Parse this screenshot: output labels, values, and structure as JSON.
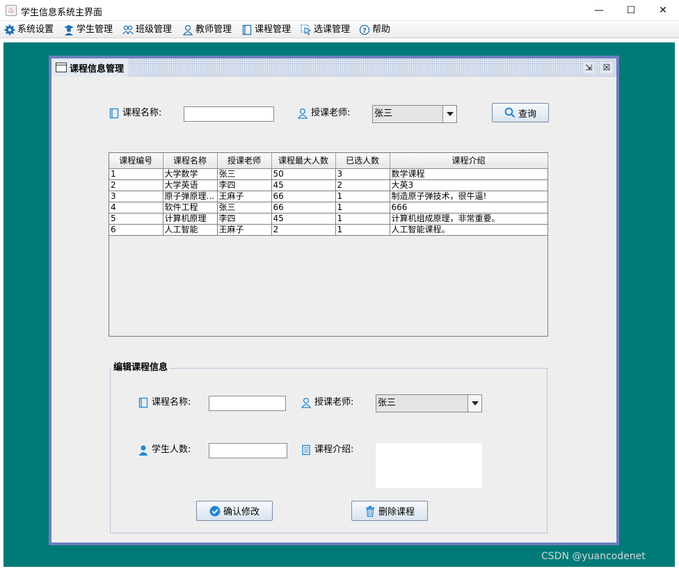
{
  "window": {
    "title": "学生信息系统主界面",
    "minimize": "—",
    "maximize": "☐",
    "close": "✕"
  },
  "menu": [
    {
      "label": "系统设置",
      "icon": "gear-icon"
    },
    {
      "label": "学生管理",
      "icon": "student-icon"
    },
    {
      "label": "班级管理",
      "icon": "class-icon"
    },
    {
      "label": "教师管理",
      "icon": "teacher-icon"
    },
    {
      "label": "课程管理",
      "icon": "book-icon"
    },
    {
      "label": "选课管理",
      "icon": "cursor-select-icon"
    },
    {
      "label": "帮助",
      "icon": "help-icon"
    }
  ],
  "frame": {
    "title": "课程信息管理",
    "restore": "⇲",
    "close": "☒"
  },
  "search": {
    "course_label": "课程名称:",
    "course_value": "",
    "teacher_label": "授课老师:",
    "teacher_value": "张三",
    "query_button": "查询"
  },
  "table": {
    "columns": [
      "课程编号",
      "课程名称",
      "授课老师",
      "课程最大人数",
      "已选人数",
      "课程介绍"
    ],
    "rows": [
      [
        "1",
        "大学数学",
        "张三",
        "50",
        "3",
        "数学课程"
      ],
      [
        "2",
        "大学英语",
        "李四",
        "45",
        "2",
        "大英3"
      ],
      [
        "3",
        "原子弹原理...",
        "王麻子",
        "66",
        "1",
        "制造原子弹技术，很牛逼!"
      ],
      [
        "4",
        "软件工程",
        "张三",
        "66",
        "1",
        "666"
      ],
      [
        "5",
        "计算机原理",
        "李四",
        "45",
        "1",
        "计算机组成原理，非常重要。"
      ],
      [
        "6",
        "人工智能",
        "王麻子",
        "2",
        "1",
        "人工智能课程。"
      ]
    ]
  },
  "edit": {
    "group_title": "编辑课程信息",
    "course_label": "课程名称:",
    "course_value": "",
    "teacher_label": "授课老师:",
    "teacher_value": "张三",
    "students_label": "学生人数:",
    "students_value": "",
    "intro_label": "课程介绍:",
    "intro_value": "",
    "confirm_button": "确认修改",
    "delete_button": "删除课程"
  },
  "watermark": "CSDN @yuancodenet",
  "colors": {
    "desktop": "#007a78",
    "frame_border": "#6b7fbd",
    "icon_blue": "#1e88d6"
  }
}
